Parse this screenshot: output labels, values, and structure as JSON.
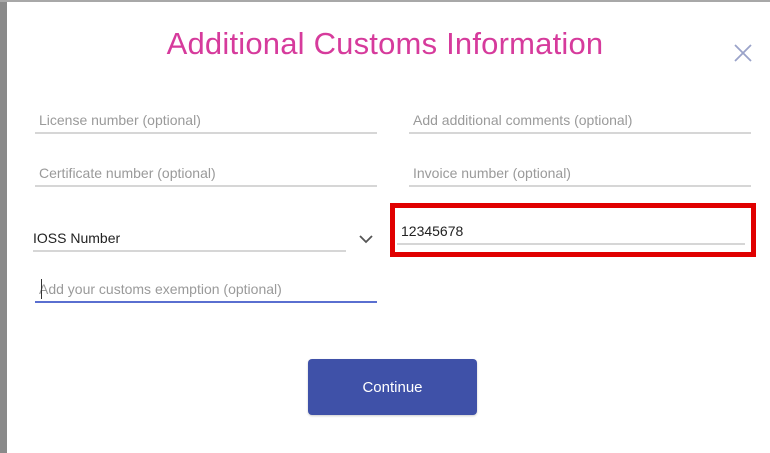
{
  "dialog": {
    "title": "Additional Customs Information",
    "close_icon": "close-icon"
  },
  "fields": {
    "license": {
      "placeholder": "License number (optional)",
      "value": ""
    },
    "comments": {
      "placeholder": "Add additional comments (optional)",
      "value": ""
    },
    "certificate": {
      "placeholder": "Certificate number (optional)",
      "value": ""
    },
    "invoice": {
      "placeholder": "Invoice number (optional)",
      "value": ""
    },
    "id_type": {
      "selected": "IOSS Number",
      "chevron_icon": "chevron-down-icon"
    },
    "ioss": {
      "value": "12345678"
    },
    "exemption": {
      "placeholder": "Add your customs exemption (optional)",
      "value": ""
    }
  },
  "actions": {
    "continue_label": "Continue"
  },
  "colors": {
    "title": "#d63b9c",
    "button": "#3f51a8",
    "highlight": "#e00000",
    "focus_underline": "#5a6fd0"
  }
}
